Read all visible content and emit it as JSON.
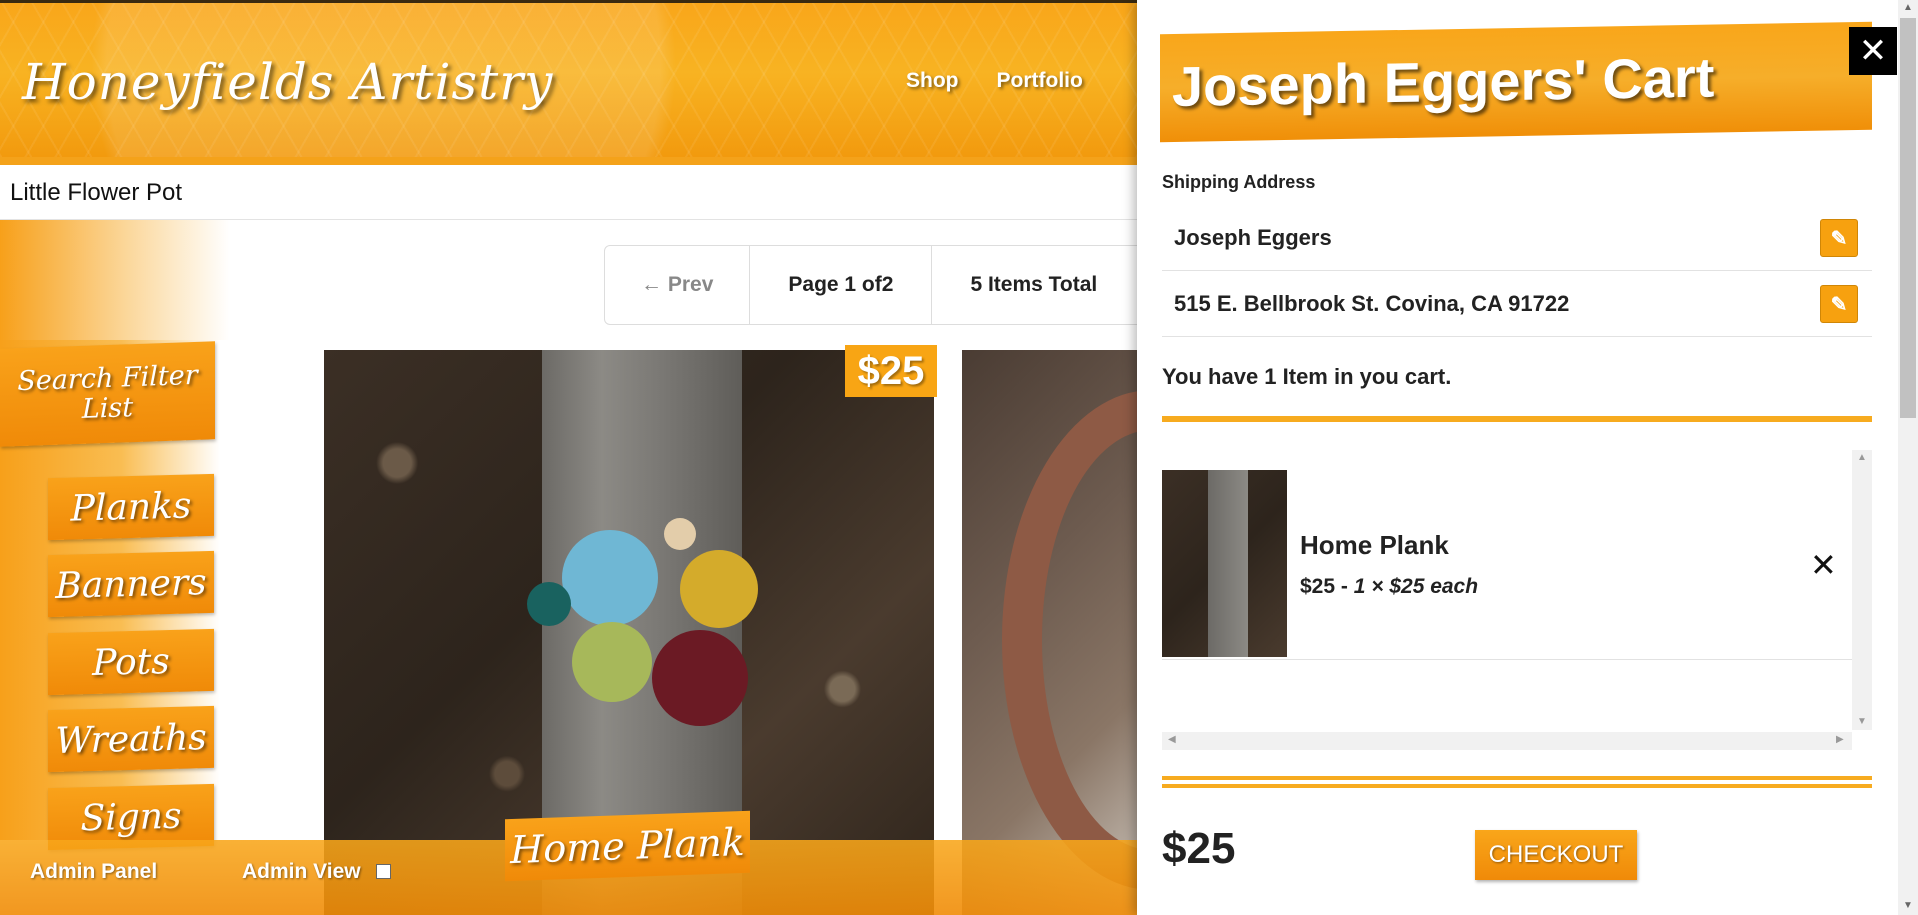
{
  "header": {
    "logo": "Honeyfields Artistry",
    "nav": [
      "Shop",
      "Portfolio"
    ]
  },
  "product_title": "Little Flower Pot",
  "sidebar": {
    "filter_label": "Search Filter List",
    "categories": [
      "Planks",
      "Banners",
      "Pots",
      "Wreaths",
      "Signs"
    ]
  },
  "pagination": {
    "prev": "Prev",
    "page": "Page 1 of2",
    "total": "5 Items Total"
  },
  "products": [
    {
      "name": "Home Plank",
      "price": "$25"
    }
  ],
  "admin": {
    "panel": "Admin Panel",
    "view": "Admin View"
  },
  "cart": {
    "title": "Joseph Eggers' Cart",
    "shipping_label": "Shipping Address",
    "name": "Joseph Eggers",
    "address": "515 E. Bellbrook St. Covina, CA 91722",
    "count_text": "You have 1 Item in you cart.",
    "items": [
      {
        "name": "Home Plank",
        "price": "$25",
        "qty_text": "1 × $25 each"
      }
    ],
    "total": "$25",
    "checkout": "CHECKOUT"
  },
  "colors": {
    "accent": "#f7a10f",
    "accent_dark": "#f08a08"
  }
}
